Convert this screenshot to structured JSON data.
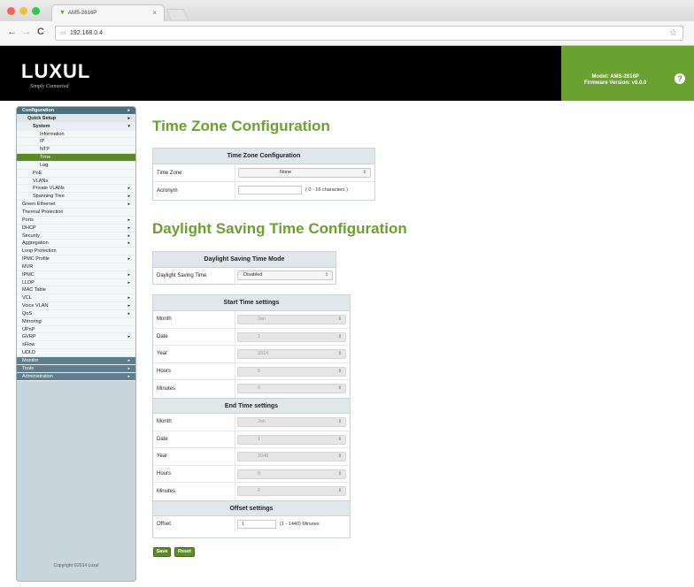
{
  "browser": {
    "tab_title": "AMS-2616P",
    "tab_close": "×",
    "url": "192.168.0.4",
    "back": "←",
    "forward": "→",
    "reload": "C",
    "bookmark": "☆"
  },
  "header": {
    "logo": "LUXUL",
    "tagline": "Simply Connected",
    "model": "Model: AMS-2616P",
    "firmware": "Firmware Version: v8.0.0",
    "help_icon": "?"
  },
  "sidebar": {
    "items": [
      {
        "label": "Configuration",
        "kind": "head",
        "arrow": "▸"
      },
      {
        "label": "Quick Setup",
        "kind": "sub",
        "arrow": "▸"
      },
      {
        "label": "System",
        "kind": "sub2",
        "arrow": "▾"
      },
      {
        "label": "Information",
        "kind": "l3"
      },
      {
        "label": "IP",
        "kind": "l3"
      },
      {
        "label": "NTP",
        "kind": "l3"
      },
      {
        "label": "Time",
        "kind": "l3 sel"
      },
      {
        "label": "Log",
        "kind": "l3"
      },
      {
        "label": "PoE",
        "kind": "l2"
      },
      {
        "label": "VLANs",
        "kind": "l2"
      },
      {
        "label": "Private VLANs",
        "kind": "l2",
        "arrow": "▸"
      },
      {
        "label": "Spanning Tree",
        "kind": "l2",
        "arrow": "▸"
      },
      {
        "label": "Green Ethernet",
        "kind": "",
        "arrow": "▸"
      },
      {
        "label": "Thermal Protection",
        "kind": ""
      },
      {
        "label": "Ports",
        "kind": "",
        "arrow": "▸"
      },
      {
        "label": "DHCP",
        "kind": "",
        "arrow": "▸"
      },
      {
        "label": "Security",
        "kind": "",
        "arrow": "▸"
      },
      {
        "label": "Aggregation",
        "kind": "",
        "arrow": "▸"
      },
      {
        "label": "Loop Protection",
        "kind": ""
      },
      {
        "label": "IPMC Profile",
        "kind": "",
        "arrow": "▸"
      },
      {
        "label": "MVR",
        "kind": ""
      },
      {
        "label": "IPMC",
        "kind": "",
        "arrow": "▸"
      },
      {
        "label": "LLDP",
        "kind": "",
        "arrow": "▸"
      },
      {
        "label": "MAC Table",
        "kind": ""
      },
      {
        "label": "VCL",
        "kind": "",
        "arrow": "▸"
      },
      {
        "label": "Voice VLAN",
        "kind": "",
        "arrow": "▸"
      },
      {
        "label": "QoS",
        "kind": "",
        "arrow": "▸"
      },
      {
        "label": "Mirroring",
        "kind": ""
      },
      {
        "label": "UPnP",
        "kind": ""
      },
      {
        "label": "GVRP",
        "kind": "",
        "arrow": "▸"
      },
      {
        "label": "sFlow",
        "kind": ""
      },
      {
        "label": "UDLD",
        "kind": ""
      },
      {
        "label": "Monitor",
        "kind": "bottom",
        "arrow": "▸"
      },
      {
        "label": "Tools",
        "kind": "bottom",
        "arrow": "▸"
      },
      {
        "label": "Administration",
        "kind": "bottom",
        "arrow": "▸"
      }
    ],
    "copyright": "Copyright ©2014 Luxul"
  },
  "main": {
    "tz_heading": "Time Zone Configuration",
    "tz_panel": {
      "title": "Time Zone Configuration",
      "time_zone_label": "Time Zone",
      "time_zone_value": "None",
      "acronym_label": "Acronym",
      "acronym_value": "",
      "acronym_hint": "( 0 - 16 characters )"
    },
    "dst_heading": "Daylight Saving Time Configuration",
    "dst_mode_panel": {
      "title": "Daylight Saving Time Mode",
      "label": "Daylight Saving Time",
      "value": "Disabled"
    },
    "start_panel": {
      "title": "Start Time settings",
      "rows": [
        {
          "label": "Month",
          "value": "Jan"
        },
        {
          "label": "Date",
          "value": "1"
        },
        {
          "label": "Year",
          "value": "2014"
        },
        {
          "label": "Hours",
          "value": "0"
        },
        {
          "label": "Minutes",
          "value": "0"
        }
      ]
    },
    "end_panel": {
      "title": "End Time settings",
      "rows": [
        {
          "label": "Month",
          "value": "Jan"
        },
        {
          "label": "Date",
          "value": "1"
        },
        {
          "label": "Year",
          "value": "2048"
        },
        {
          "label": "Hours",
          "value": "0"
        },
        {
          "label": "Minutes",
          "value": "0"
        }
      ]
    },
    "offset_panel": {
      "title": "Offset settings",
      "label": "Offset",
      "value": "1",
      "hint": "(1 - 1440) Minutes"
    },
    "save_label": "Save",
    "reset_label": "Reset"
  },
  "colors": {
    "brand_green": "#6aa130",
    "header_bg": "#000000",
    "sidebar_selected": "#5b8a25"
  },
  "icons": {
    "dropdown": "chevron-updown-icon",
    "help": "question-circle-icon",
    "submenu": "triangle-right-icon"
  }
}
